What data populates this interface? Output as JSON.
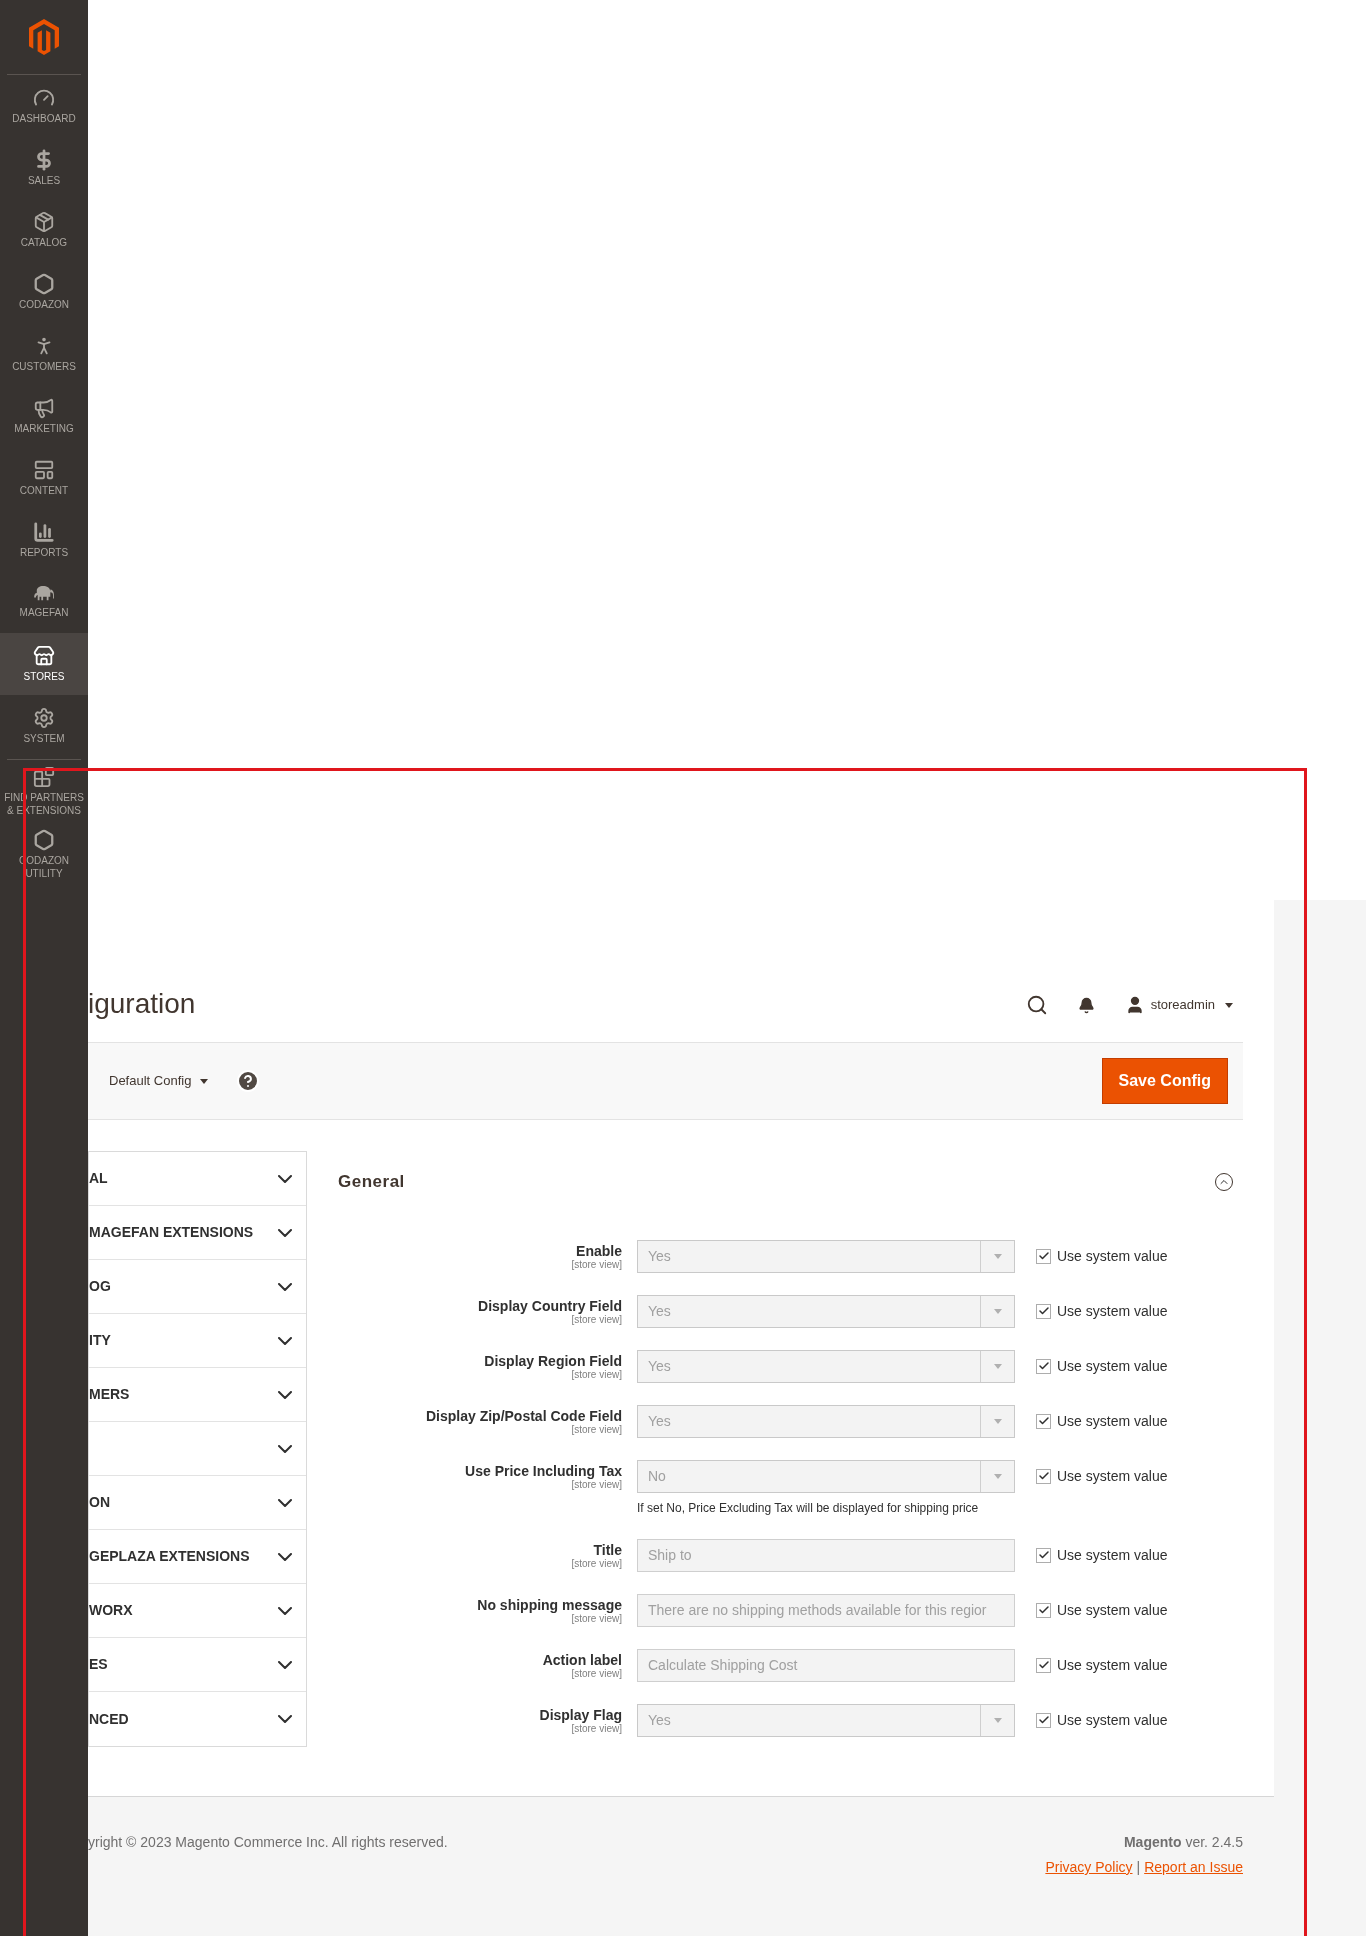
{
  "sidebar": {
    "items": [
      {
        "kind": "dashboard",
        "label": "DASHBOARD",
        "selected": false
      },
      {
        "kind": "sales",
        "label": "SALES",
        "selected": false
      },
      {
        "kind": "catalog",
        "label": "CATALOG",
        "selected": false
      },
      {
        "kind": "hexagon",
        "label": "CODAZON",
        "selected": false
      },
      {
        "kind": "customers",
        "label": "CUSTOMERS",
        "selected": false
      },
      {
        "kind": "marketing",
        "label": "MARKETING",
        "selected": false
      },
      {
        "kind": "content",
        "label": "CONTENT",
        "selected": false
      },
      {
        "kind": "reports",
        "label": "REPORTS",
        "selected": false
      },
      {
        "kind": "elephant",
        "label": "MAGEFAN",
        "selected": false
      },
      {
        "kind": "stores",
        "label": "STORES",
        "selected": true
      },
      {
        "kind": "system",
        "label": "SYSTEM",
        "selected": false
      },
      {
        "kind": "partners",
        "label": "FIND PARTNERS & EXTENSIONS",
        "selected": false
      },
      {
        "kind": "hexagon",
        "label": "CODAZON UTILITY",
        "selected": false
      }
    ]
  },
  "page_title": "iguration",
  "header": {
    "user": "storeadmin"
  },
  "toolbar": {
    "scope": "Default Config",
    "save_button": "Save Config"
  },
  "tabs": [
    {
      "label": "AL",
      "expanded": false
    },
    {
      "label": "MAGEFAN EXTENSIONS",
      "expanded": false
    },
    {
      "label": "OG",
      "expanded": false
    },
    {
      "label": "ITY",
      "expanded": false
    },
    {
      "label": "MERS",
      "expanded": false
    },
    {
      "expanded": false
    },
    {
      "label": "ON",
      "expanded": false
    },
    {
      "label": "GEPLAZA EXTENSIONS",
      "expanded": false
    },
    {
      "label": "WORX",
      "expanded": false
    },
    {
      "label": "ES",
      "expanded": false
    },
    {
      "label": "NCED",
      "expanded": false
    }
  ],
  "section": {
    "title": "General",
    "expanded": true,
    "fields": [
      {
        "kind": "select",
        "label": "Enable",
        "scope": "[store view]",
        "value": "Yes",
        "use_system_value": {
          "label": "Use system value",
          "checked": true
        }
      },
      {
        "kind": "select",
        "label": "Display Country Field",
        "scope": "[store view]",
        "value": "Yes",
        "use_system_value": {
          "label": "Use system value",
          "checked": true
        }
      },
      {
        "kind": "select",
        "label": "Display Region Field",
        "scope": "[store view]",
        "value": "Yes",
        "use_system_value": {
          "label": "Use system value",
          "checked": true
        }
      },
      {
        "kind": "select",
        "label": "Display Zip/Postal Code Field",
        "scope": "[store view]",
        "value": "Yes",
        "use_system_value": {
          "label": "Use system value",
          "checked": true
        }
      },
      {
        "kind": "select",
        "label": "Use Price Including Tax",
        "scope": "[store view]",
        "value": "No",
        "note": "If set No, Price Excluding Tax will be displayed for shipping price",
        "use_system_value": {
          "label": "Use system value",
          "checked": true
        }
      },
      {
        "kind": "text",
        "label": "Title",
        "scope": "[store view]",
        "value": "Ship to",
        "use_system_value": {
          "label": "Use system value",
          "checked": true
        }
      },
      {
        "kind": "text",
        "label": "No shipping message",
        "scope": "[store view]",
        "value": "There are no shipping methods available for this regior",
        "use_system_value": {
          "label": "Use system value",
          "checked": true
        }
      },
      {
        "kind": "text",
        "label": "Action label",
        "scope": "[store view]",
        "value": "Calculate Shipping Cost",
        "use_system_value": {
          "label": "Use system value",
          "checked": true
        }
      },
      {
        "kind": "select",
        "label": "Display Flag",
        "scope": "[store view]",
        "value": "Yes",
        "use_system_value": {
          "label": "Use system value",
          "checked": true
        }
      }
    ]
  },
  "footer": {
    "copyright": "yright © 2023 Magento Commerce Inc. All rights reserved.",
    "version": "**Magento** ver. 2.4.5",
    "links": [
      {
        "label": "Privacy Policy"
      },
      {
        "label": "Report an Issue"
      }
    ],
    "separator": "|"
  }
}
